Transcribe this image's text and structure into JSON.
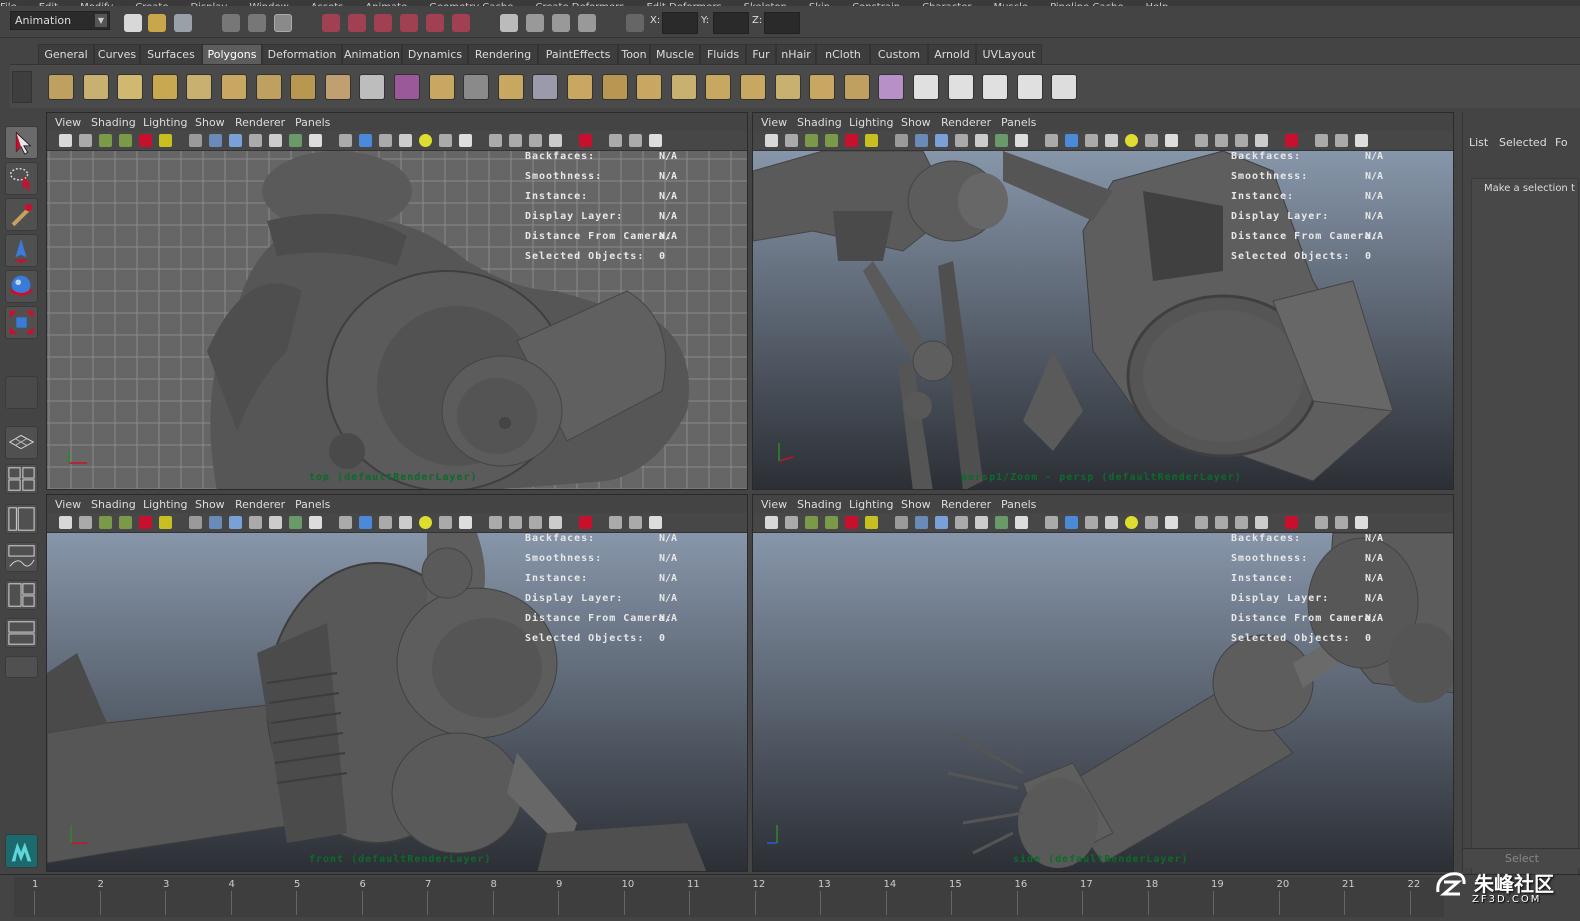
{
  "menu_bar": {
    "items": [
      "File",
      "Edit",
      "Modify",
      "Create",
      "Display",
      "Window",
      "Assets",
      "Animate",
      "Geometry Cache",
      "Create Deformers",
      "Edit Deformers",
      "Skeleton",
      "Skin",
      "Constrain",
      "Character",
      "Muscle",
      "Pipeline Cache",
      "Help"
    ]
  },
  "status_line": {
    "mode": "Animation",
    "x_label": "X:",
    "y_label": "Y:",
    "z_label": "Z:"
  },
  "shelf": {
    "tabs": [
      "General",
      "Curves",
      "Surfaces",
      "Polygons",
      "Deformation",
      "Animation",
      "Dynamics",
      "Rendering",
      "PaintEffects",
      "Toon",
      "Muscle",
      "Fluids",
      "Fur",
      "nHair",
      "nCloth",
      "Custom",
      "Arnold",
      "UVLayout"
    ],
    "active_tab": "Polygons",
    "icons": [
      "poly-sphere-icon",
      "poly-cube-icon",
      "poly-cylinder-icon",
      "poly-cone-icon",
      "poly-plane-icon",
      "poly-torus-icon",
      "poly-prism-icon",
      "poly-pipe-icon",
      "poly-helix-icon",
      "poly-soccer-ball-icon",
      "poly-platonic-icon",
      "poly-pyramid-icon",
      "combine-icon",
      "separate-icon",
      "extract-icon",
      "booleans-icon",
      "smooth-icon",
      "average-vertices-icon",
      "extrude-icon",
      "bridge-icon",
      "append-polygon-icon",
      "split-polygon-icon",
      "insert-edge-loop-icon",
      "offset-edge-loop-icon",
      "sculpt-geometry-icon",
      "uv-planar-icon",
      "uv-cylindrical-icon",
      "uv-spherical-icon",
      "uv-automatic-icon",
      "uv-editor-icon"
    ]
  },
  "toolbox": {
    "tools": [
      "select-tool-icon",
      "lasso-tool-icon",
      "paint-select-tool-icon",
      "move-tool-icon",
      "rotate-tool-icon",
      "scale-tool-icon",
      "last-tool-icon"
    ],
    "layouts": [
      "single-perspective-layout-icon",
      "four-view-layout-icon",
      "outliner-perspective-layout-icon",
      "graph-editor-layout-icon",
      "hypershade-layout-icon",
      "dope-sheet-layout-icon",
      "custom-layout-icon"
    ]
  },
  "viewport_menu": {
    "view": "View",
    "shading": "Shading",
    "lighting": "Lighting",
    "show": "Show",
    "renderer": "Renderer",
    "panels": "Panels"
  },
  "hud": {
    "backfaces_label": "Backfaces:",
    "backfaces_value": "N/A",
    "smoothness_label": "Smoothness:",
    "smoothness_value": "N/A",
    "instance_label": "Instance:",
    "instance_value": "N/A",
    "display_layer_label": "Display Layer:",
    "display_layer_value": "N/A",
    "distance_label": "Distance From Camera:",
    "distance_value": "N/A",
    "selected_label": "Selected Objects:",
    "selected_value": "0"
  },
  "viewports": [
    {
      "camera": "top (defaultRenderLayer)"
    },
    {
      "camera": "persp1/Zoom - persp (defaultRenderLayer)"
    },
    {
      "camera": "front (defaultRenderLayer)"
    },
    {
      "camera": "side (defaultRenderLayer)"
    }
  ],
  "right_panel": {
    "tabs": [
      "List",
      "Selected",
      "Fo"
    ],
    "message": "Make a selection t",
    "select_button": "Select"
  },
  "time_slider": {
    "ticks": [
      1,
      2,
      3,
      4,
      5,
      6,
      7,
      8,
      9,
      10,
      11,
      12,
      13,
      14,
      15,
      16,
      17,
      18,
      19,
      20,
      21,
      22
    ]
  },
  "watermark": {
    "cn_text": "朱峰社区",
    "en_text": "ZF3D.COM"
  },
  "colors": {
    "accent_select": "#c8102e",
    "viewport_gray": "#6a6a6a",
    "gradient_top": "#8796aa",
    "gradient_bottom": "#2c2f35",
    "camera_label": "#0b6b2a"
  }
}
